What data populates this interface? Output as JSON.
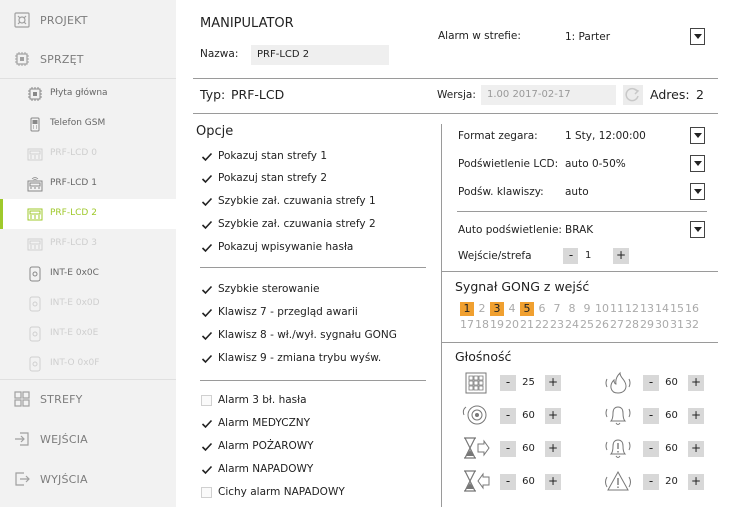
{
  "sidebar": {
    "main_items": [
      {
        "label": "PROJEKT",
        "icon": "projekt-icon"
      },
      {
        "label": "SPRZĘT",
        "icon": "chip-icon"
      },
      {
        "label": "STREFY",
        "icon": "zones-icon"
      },
      {
        "label": "WEJŚCIA",
        "icon": "input-icon"
      },
      {
        "label": "WYJŚCIA",
        "icon": "output-icon"
      }
    ],
    "sub_items": [
      {
        "label": "Płyta główna",
        "icon": "mainboard-icon",
        "state": "normal"
      },
      {
        "label": "Telefon GSM",
        "icon": "gsm-phone-icon",
        "state": "normal"
      },
      {
        "label": "PRF-LCD 0",
        "icon": "keypad-icon",
        "state": "disabled"
      },
      {
        "label": "PRF-LCD 1",
        "icon": "wireless-keypad-icon",
        "state": "normal"
      },
      {
        "label": "PRF-LCD 2",
        "icon": "keypad-icon",
        "state": "active"
      },
      {
        "label": "PRF-LCD 3",
        "icon": "keypad-icon",
        "state": "disabled"
      },
      {
        "label": "INT-E 0x0C",
        "icon": "expander-icon",
        "state": "normal"
      },
      {
        "label": "INT-E 0x0D",
        "icon": "expander-icon",
        "state": "disabled"
      },
      {
        "label": "INT-E 0x0E",
        "icon": "expander-icon",
        "state": "disabled"
      },
      {
        "label": "INT-O 0x0F",
        "icon": "expander-icon",
        "state": "disabled"
      }
    ]
  },
  "header": {
    "section_title": "MANIPULATOR",
    "name_label": "Nazwa:",
    "name_value": "PRF-LCD 2",
    "alarm_zone_label": "Alarm w strefie:",
    "alarm_zone_value": "1: Parter"
  },
  "info": {
    "type_label": "Typ:",
    "type_value": "PRF-LCD",
    "version_label": "Wersja:",
    "version_value": "1.00 2017-02-17",
    "address_label": "Adres:",
    "address_value": "2"
  },
  "options": {
    "title": "Opcje",
    "group1": [
      {
        "label": "Pokazuj stan strefy 1",
        "checked": true
      },
      {
        "label": "Pokazuj stan strefy 2",
        "checked": true
      },
      {
        "label": "Szybkie zał. czuwania strefy 1",
        "checked": true
      },
      {
        "label": "Szybkie zał. czuwania strefy 2",
        "checked": true
      },
      {
        "label": "Pokazuj wpisywanie hasła",
        "checked": true
      }
    ],
    "group2": [
      {
        "label": "Szybkie sterowanie",
        "checked": true
      },
      {
        "label": "Klawisz 7 - przegląd awarii",
        "checked": true
      },
      {
        "label": "Klawisz 8 - wł./wył. sygnału GONG",
        "checked": true
      },
      {
        "label": "Klawisz 9  - zmiana trybu wyśw.",
        "checked": true
      }
    ],
    "group3": [
      {
        "label": "Alarm 3 bł. hasła",
        "checked": false
      },
      {
        "label": "Alarm MEDYCZNY",
        "checked": true
      },
      {
        "label": "Alarm POŻAROWY",
        "checked": true
      },
      {
        "label": "Alarm NAPADOWY",
        "checked": true
      },
      {
        "label": "Cichy alarm NAPADOWY",
        "checked": false
      }
    ]
  },
  "settings": {
    "clock_format_label": "Format zegara:",
    "clock_format_value": "1 Sty, 12:00:00",
    "backlight_lcd_label": "Podświetlenie  LCD:",
    "backlight_lcd_value": "auto 0-50%",
    "backlight_keys_label": "Podśw. klawiszy:",
    "backlight_keys_value": "auto",
    "auto_backlight_label": "Auto podświetlenie:",
    "auto_backlight_value": "BRAK",
    "input_zone_label": "Wejście/strefa",
    "input_zone_value": "1",
    "minus": "-",
    "plus": "+"
  },
  "gong": {
    "title": "Sygnał GONG z wejść",
    "row1": [
      "1",
      "2",
      "3",
      "4",
      "5",
      "6",
      "7",
      "8",
      "9",
      "10",
      "11",
      "12",
      "13",
      "14",
      "15",
      "16"
    ],
    "row2": [
      "17",
      "18",
      "19",
      "20",
      "21",
      "22",
      "23",
      "24",
      "25",
      "26",
      "27",
      "28",
      "29",
      "30",
      "31",
      "32"
    ],
    "active": [
      "1",
      "3",
      "5"
    ]
  },
  "volume": {
    "title": "Głośność",
    "items": [
      {
        "icon": "keypad-sound-icon",
        "value": "25"
      },
      {
        "icon": "fire-alarm-icon",
        "value": "60"
      },
      {
        "icon": "speaker-icon",
        "value": "60"
      },
      {
        "icon": "bell-icon",
        "value": "60"
      },
      {
        "icon": "entry-delay-icon",
        "value": "60"
      },
      {
        "icon": "bell-alert-icon",
        "value": "60"
      },
      {
        "icon": "exit-delay-icon",
        "value": "60"
      },
      {
        "icon": "warning-icon",
        "value": "20"
      }
    ]
  },
  "colors": {
    "accent": "#9fc92b",
    "gong_active": "#f0a030"
  }
}
